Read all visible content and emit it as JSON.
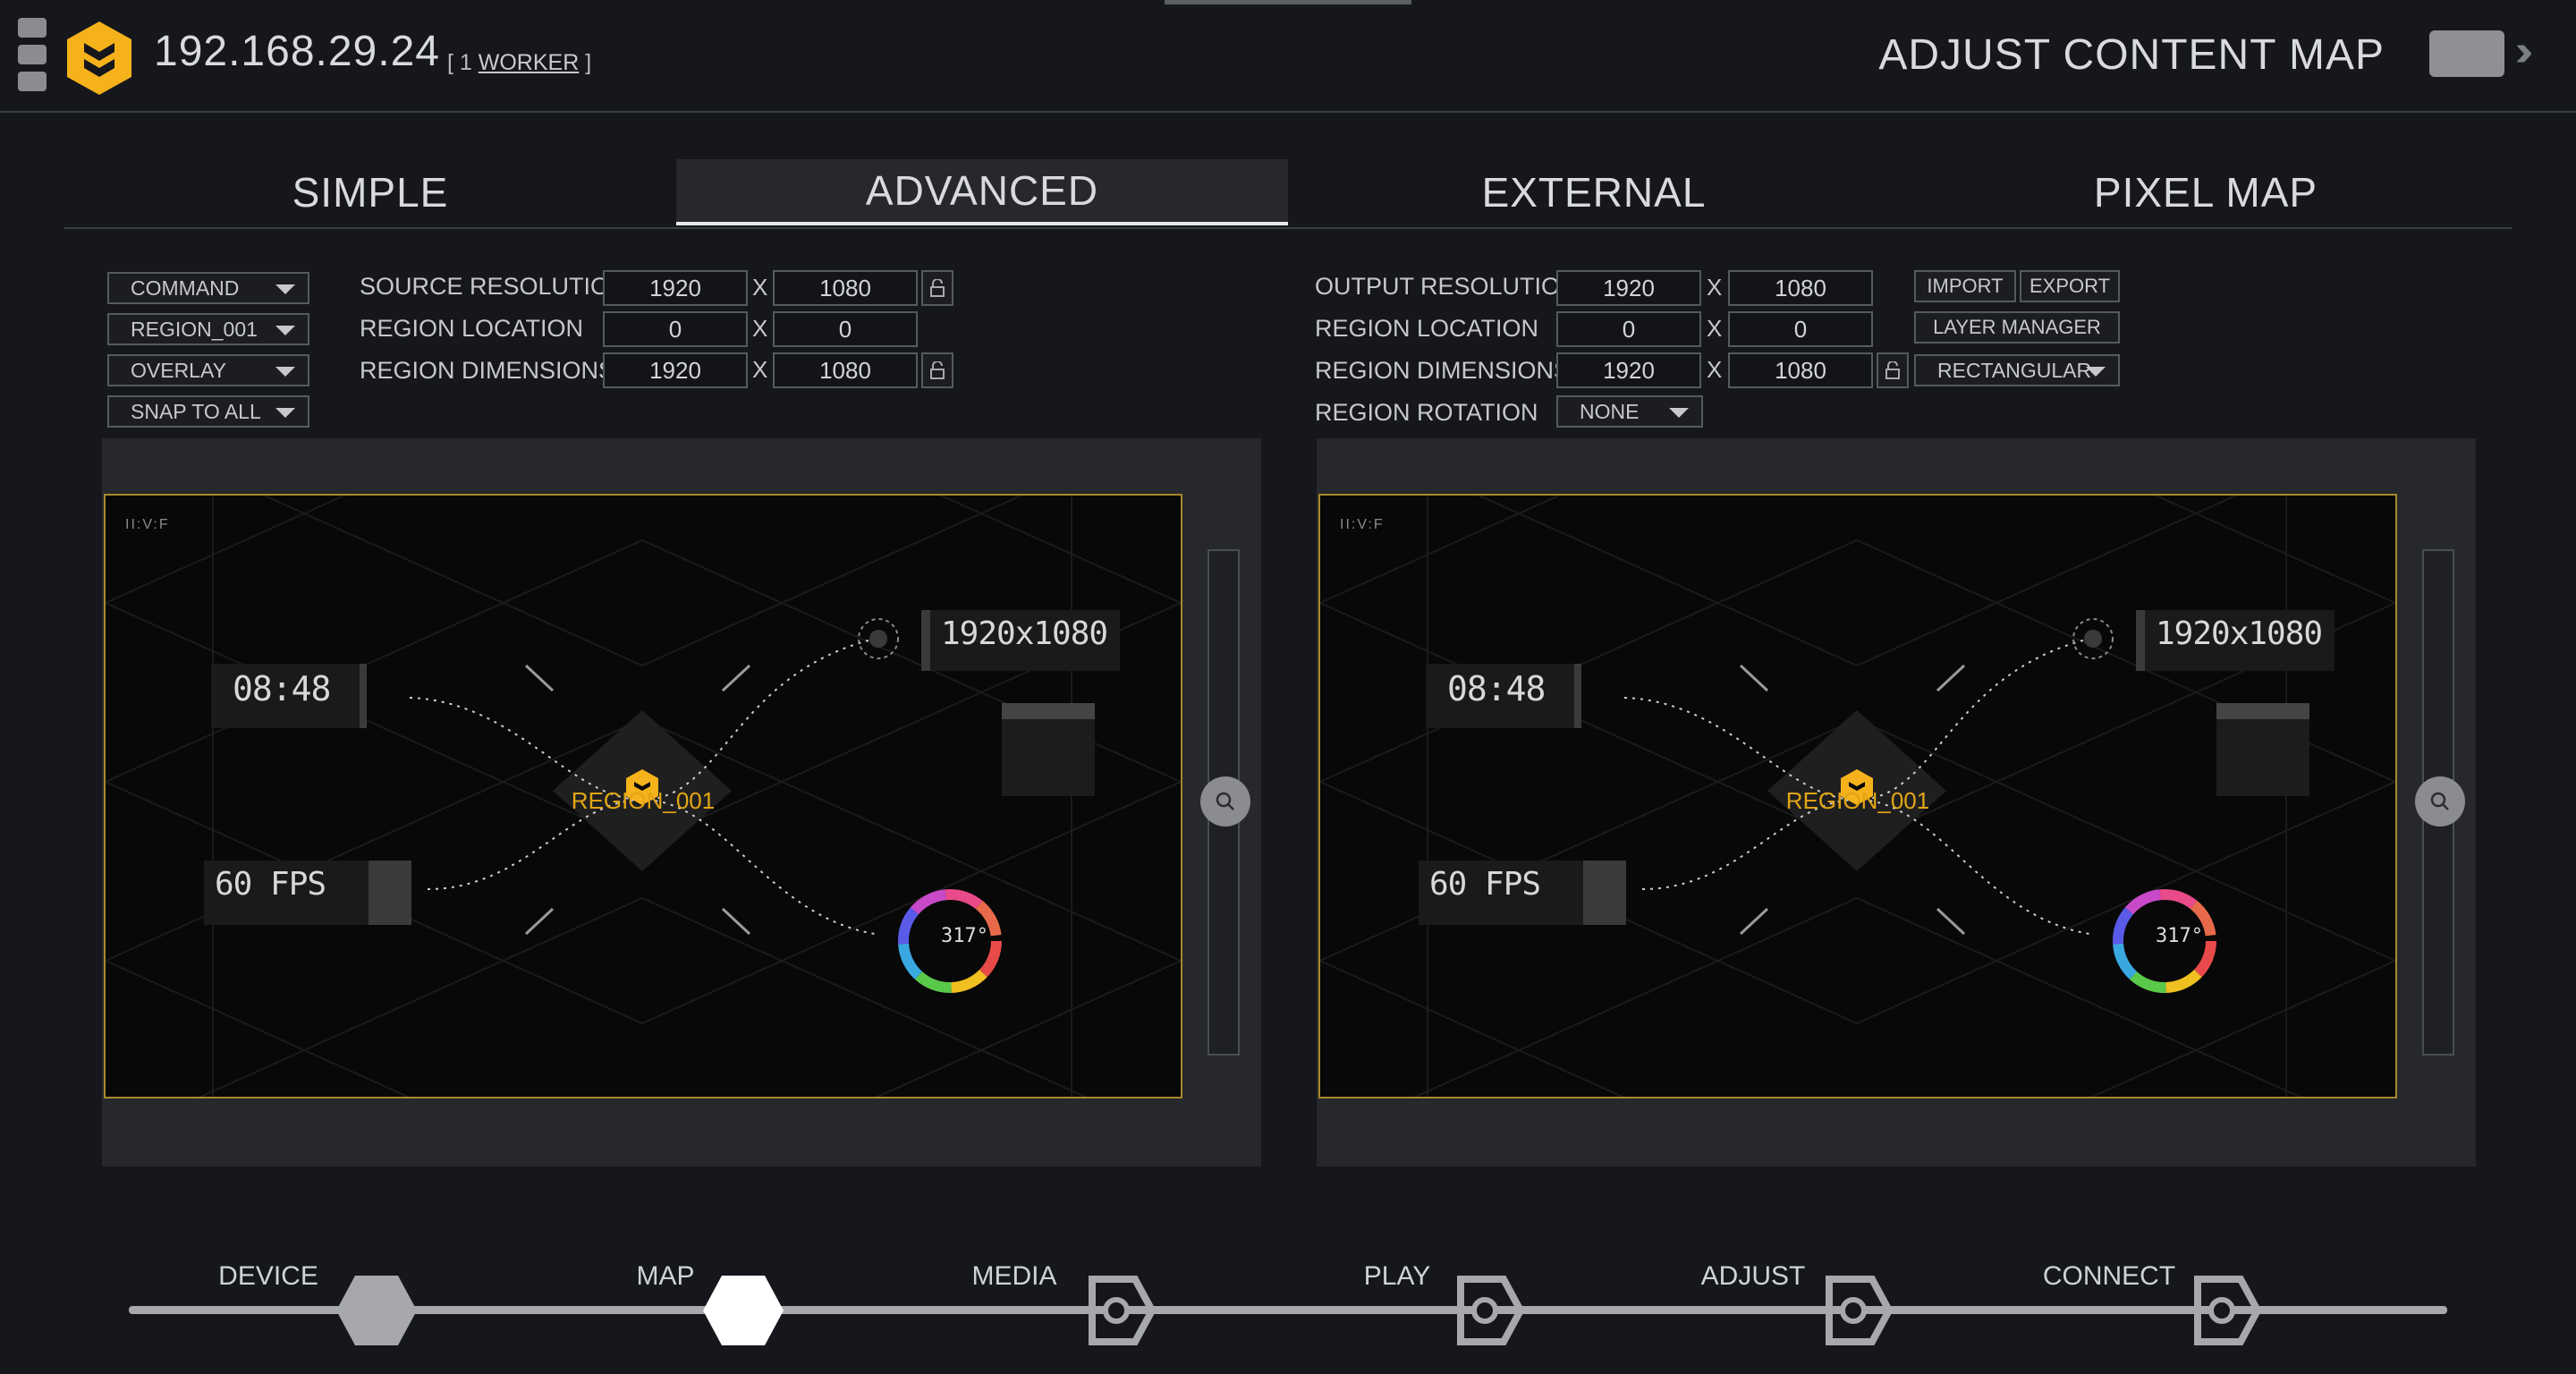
{
  "header": {
    "ip": "192.168.29.24",
    "worker_open": "[ 1 ",
    "worker_link": "WORKER",
    "worker_close": " ]",
    "title": "ADJUST CONTENT MAP"
  },
  "tabs": [
    {
      "label": "SIMPLE",
      "active": false
    },
    {
      "label": "ADVANCED",
      "active": true
    },
    {
      "label": "EXTERNAL",
      "active": false
    },
    {
      "label": "PIXEL MAP",
      "active": false
    }
  ],
  "left_controls": {
    "dropdowns": [
      "COMMAND",
      "REGION_001",
      "OVERLAY",
      "SNAP TO ALL"
    ],
    "source_resolution": {
      "label": "SOURCE RESOLUTION",
      "w": "1920",
      "h": "1080"
    },
    "region_location": {
      "label": "REGION LOCATION",
      "x": "0",
      "y": "0"
    },
    "region_dimensions": {
      "label": "REGION DIMENSIONS",
      "w": "1920",
      "h": "1080"
    }
  },
  "right_controls": {
    "output_resolution": {
      "label": "OUTPUT RESOLUTION",
      "w": "1920",
      "h": "1080"
    },
    "region_location": {
      "label": "REGION LOCATION",
      "x": "0",
      "y": "0"
    },
    "region_dimensions": {
      "label": "REGION DIMENSIONS",
      "w": "1920",
      "h": "1080"
    },
    "region_rotation": {
      "label": "REGION ROTATION",
      "value": "NONE"
    },
    "import_label": "IMPORT",
    "export_label": "EXPORT",
    "layer_manager_label": "LAYER MANAGER",
    "shape_value": "RECTANGULAR"
  },
  "x_sep": "X",
  "preview": {
    "corner_tag": "II:V:F",
    "time": "08:48",
    "resolution": "1920x1080",
    "fps": "60 FPS",
    "region_label": "REGION_001",
    "rotation_readout": "317°"
  },
  "workflow": [
    {
      "label": "DEVICE",
      "state": "done"
    },
    {
      "label": "MAP",
      "state": "current"
    },
    {
      "label": "MEDIA",
      "state": "todo"
    },
    {
      "label": "PLAY",
      "state": "todo"
    },
    {
      "label": "ADJUST",
      "state": "todo"
    },
    {
      "label": "CONNECT",
      "state": "todo"
    }
  ],
  "colors": {
    "brand": "#f5b21b",
    "region_outline": "#a8892a",
    "region_label": "#e2a514",
    "background": "#15171c"
  }
}
